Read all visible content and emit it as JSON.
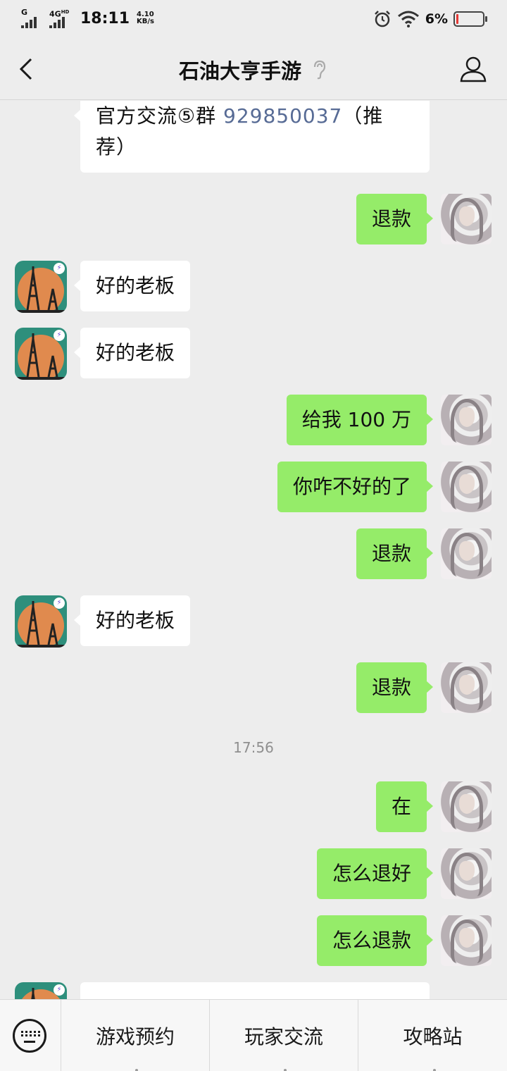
{
  "status_bar": {
    "net1": "G",
    "net2": "4G",
    "net2_sup": "HD",
    "time": "18:11",
    "speed_value": "4.10",
    "speed_unit": "KB/s",
    "battery_percent": "6%",
    "battery_level": 0.06,
    "icons": [
      "alarm-icon",
      "wifi-icon",
      "battery-icon"
    ]
  },
  "header": {
    "title": "石油大亨手游",
    "icons": [
      "back-arrow-icon",
      "ear-icon",
      "profile-icon"
    ]
  },
  "messages": [
    {
      "side": "left",
      "avatar": false,
      "parts": [
        "官方交流⑤群 ",
        "929850037",
        "（推荐）"
      ]
    },
    {
      "side": "right",
      "text": "退款"
    },
    {
      "side": "left",
      "text": "好的老板"
    },
    {
      "side": "left",
      "text": "好的老板"
    },
    {
      "side": "right",
      "text": "给我 100 万"
    },
    {
      "side": "right",
      "text": "你咋不好的了"
    },
    {
      "side": "right",
      "text": "退款"
    },
    {
      "side": "left",
      "text": "好的老板"
    },
    {
      "side": "right",
      "text": "退款"
    },
    {
      "side": "right",
      "text": "在"
    },
    {
      "side": "right",
      "text": "怎么退好"
    },
    {
      "side": "right",
      "text": "怎么退款"
    }
  ],
  "timestamp": "17:56",
  "bottom_menu": {
    "items": [
      "游戏预约",
      "玩家交流",
      "攻略站"
    ],
    "icons": [
      "keyboard-icon"
    ]
  },
  "colors": {
    "background": "#ededed",
    "bubble_right": "#95ec69",
    "bubble_left": "#ffffff",
    "link": "#576b95",
    "battery_low": "#e53935"
  }
}
